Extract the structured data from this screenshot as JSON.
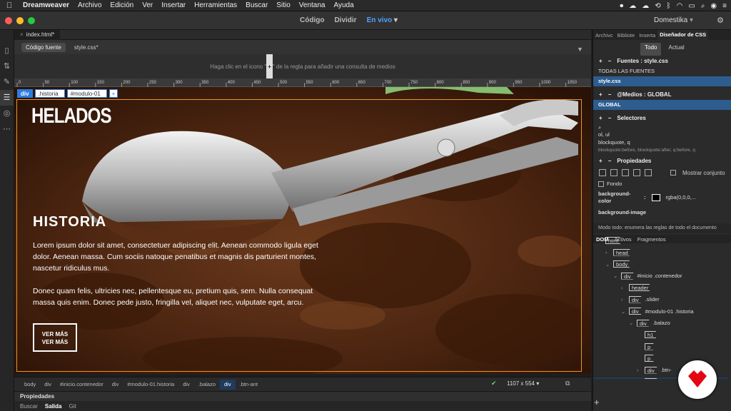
{
  "menubar": {
    "app": "Dreamweaver",
    "items": [
      "Archivo",
      "Edición",
      "Ver",
      "Insertar",
      "Herramientas",
      "Buscar",
      "Sitio",
      "Ventana",
      "Ayuda"
    ]
  },
  "titlebar": {
    "view_modes": [
      "Código",
      "Dividir",
      "En vivo"
    ],
    "workspace": "Domestika"
  },
  "document": {
    "tab": "index.html*",
    "related": [
      "Código fuente",
      "style.css*"
    ],
    "mq_hint": "Haga clic en el icono \"",
    "mq_hint_end": "\" de la regla para añadir una consulta de medios",
    "ruler_ticks": [
      "0",
      "50",
      "100",
      "150",
      "200",
      "250",
      "300",
      "350",
      "400",
      "450",
      "500",
      "550",
      "600",
      "650",
      "700",
      "750",
      "800",
      "850",
      "900",
      "950",
      "1000",
      "1050",
      "1100"
    ]
  },
  "live": {
    "tag_div": "div",
    "tag_class": ".historia",
    "tag_id": "#modulo-01",
    "tag_add": "+",
    "heading": "HELADOS",
    "section_title": "HISTORIA",
    "paragraph1": "Lorem ipsum dolor sit amet, consectetuer adipiscing elit. Aenean commodo ligula eget dolor. Aenean massa. Cum sociis natoque penatibus et magnis dis parturient montes, nascetur ridiculus mus.",
    "paragraph2": "Donec quam felis, ultricies nec, pellentesque eu, pretium quis, sem. Nulla consequat massa quis enim. Donec pede justo, fringilla vel, aliquet nec, vulputate eget, arcu.",
    "button_line1": "VER MÁS",
    "button_line2": "VER MÁS"
  },
  "tagselector": {
    "items": [
      "body",
      "div",
      "#inicio.contenedor",
      "div",
      "#modulo-01.historia",
      "div",
      ".balazo",
      "div",
      ".btn-ant"
    ],
    "size": "1107 x 554"
  },
  "bottom": {
    "properties": "Propiedades",
    "tabs": [
      "Buscar",
      "Salida",
      "Git"
    ]
  },
  "right": {
    "tabs": [
      "Archivc",
      "Bibliote",
      "Inserta",
      "Diseñador de CSS"
    ],
    "seg": [
      "Todo",
      "Actual"
    ],
    "sources_hdr": "Fuentes : style.css",
    "sources": [
      "TODAS LAS FUENTES",
      "style.css"
    ],
    "media_hdr": "@Medios : GLOBAL",
    "media": [
      "GLOBAL"
    ],
    "selectors_hdr": "Selectores",
    "selectors": [
      "ol, ul",
      "blockquote, q",
      "blockquote:before, blockquote:after, q:before, q"
    ],
    "props_hdr": "Propiedades",
    "show_set": "Mostrar conjunto",
    "fondo": "Fondo",
    "bg_color_label": "background-color",
    "bg_color_sep": ":",
    "bg_color_val": "rgba(0,0,0,...",
    "bg_image": "background-image",
    "mode_hint": "Modo todo: enumera las reglas de todo el documento",
    "dom_tabs": [
      "DOM",
      "Activos",
      "Fragmentos"
    ],
    "tree": [
      {
        "depth": 0,
        "tw": "",
        "tag": "html",
        "text": ""
      },
      {
        "depth": 1,
        "tw": "›",
        "tag": "head",
        "text": ""
      },
      {
        "depth": 1,
        "tw": "⌄",
        "tag": "body",
        "text": ""
      },
      {
        "depth": 2,
        "tw": "⌄",
        "tag": "div",
        "text": "#inicio .contenedor"
      },
      {
        "depth": 3,
        "tw": "›",
        "tag": "header",
        "text": ""
      },
      {
        "depth": 3,
        "tw": "›",
        "tag": "div",
        "text": ".slider"
      },
      {
        "depth": 3,
        "tw": "⌄",
        "tag": "div",
        "text": "#modulo-01 .historia"
      },
      {
        "depth": 4,
        "tw": "⌄",
        "tag": "div",
        "text": ".balazo"
      },
      {
        "depth": 5,
        "tw": "",
        "tag": "h1",
        "text": ""
      },
      {
        "depth": 5,
        "tw": "",
        "tag": "p",
        "text": ""
      },
      {
        "depth": 5,
        "tw": "",
        "tag": "p",
        "text": ""
      },
      {
        "depth": 5,
        "tw": "›",
        "tag": "div",
        "text": ".btn-"
      },
      {
        "depth": 5,
        "tw": "›",
        "tag": "div",
        "text": ".btn-ant"
      }
    ]
  },
  "colors": {
    "accent": "#4da3ff",
    "selection": "#e8962c",
    "brand_logo": "#e30613"
  }
}
